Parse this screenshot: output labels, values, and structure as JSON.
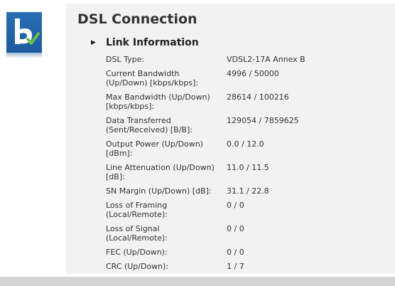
{
  "page": {
    "title": "DSL Connection"
  },
  "section": {
    "title": "Link Information",
    "toggle_icon": "triangle-right"
  },
  "rows": [
    {
      "label_lines": [
        "DSL Type:"
      ],
      "value": "VDSL2-17A Annex B"
    },
    {
      "label_lines": [
        "Current Bandwidth",
        "(Up/Down) [kbps/kbps]:"
      ],
      "value": "4996 / 50000"
    },
    {
      "label_lines": [
        "Max Bandwidth (Up/Down)",
        "[kbps/kbps]:"
      ],
      "value": "28614 / 100216"
    },
    {
      "label_lines": [
        "Data Transferred",
        "(Sent/Received) [B/B]:"
      ],
      "value": "129054 / 7859625"
    },
    {
      "label_lines": [
        "Output Power (Up/Down)",
        "[dBm]:"
      ],
      "value": "0.0 / 12.0"
    },
    {
      "label_lines": [
        "Line Attenuation (Up/Down)",
        "[dB]:"
      ],
      "value": "11.0 / 11.5"
    },
    {
      "label_lines": [
        "SN Margin (Up/Down) [dB]:"
      ],
      "value": "31.1 / 22.8"
    },
    {
      "label_lines": [
        "Loss of Framing",
        "(Local/Remote):"
      ],
      "value": "0 / 0"
    },
    {
      "label_lines": [
        "Loss of Signal",
        "(Local/Remote):"
      ],
      "value": "0 / 0"
    },
    {
      "label_lines": [
        "FEC (Up/Down):"
      ],
      "value": "0 / 0"
    },
    {
      "label_lines": [
        "CRC (Up/Down):"
      ],
      "value": "1 / 7"
    }
  ],
  "colors": {
    "logo_blue": "#1f63ab",
    "check_green": "#6cc04a",
    "panel_bg": "#f2f2f2"
  }
}
